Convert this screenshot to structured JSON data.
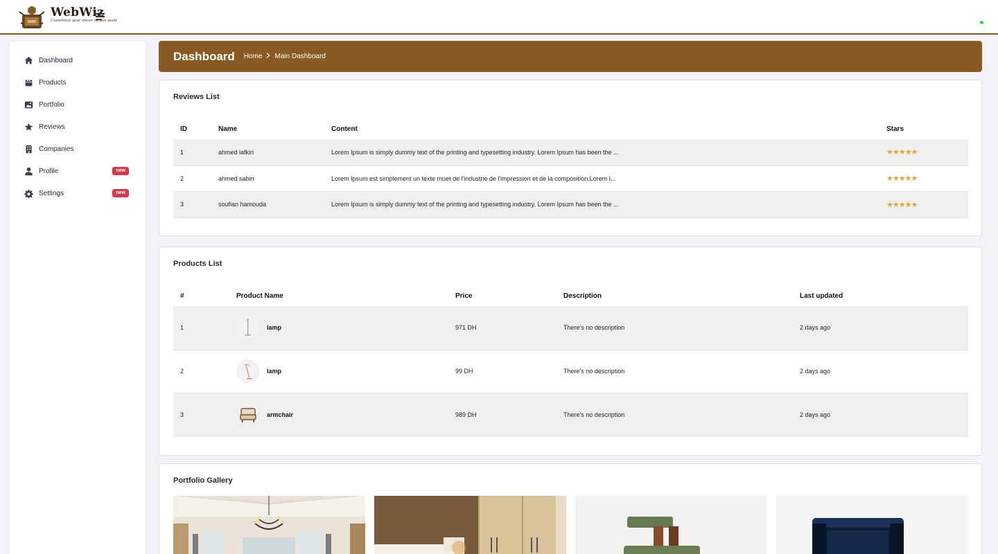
{
  "app": {
    "brand_name": "WebWiz",
    "brand_tagline": "Customize your décor as you want"
  },
  "sidebar": {
    "items": [
      {
        "label": "Dashboard",
        "icon": "home-icon"
      },
      {
        "label": "Products",
        "icon": "box-icon"
      },
      {
        "label": "Portfolio",
        "icon": "image-icon"
      },
      {
        "label": "Reviews",
        "icon": "star-icon"
      },
      {
        "label": "Companies",
        "icon": "building-icon"
      },
      {
        "label": "Profile",
        "icon": "user-icon",
        "badge": "new"
      },
      {
        "label": "Settings",
        "icon": "gear-icon",
        "badge": "new"
      }
    ]
  },
  "header": {
    "title": "Dashboard",
    "breadcrumb": [
      "Home",
      "Main Dashboard"
    ]
  },
  "reviews": {
    "title": "Reviews List",
    "columns": [
      "ID",
      "Name",
      "Content",
      "Stars"
    ],
    "rows": [
      {
        "id": "1",
        "name": "ahmed lafkiri",
        "content": "Lorem Ipsum is simply dummy text of the printing and typesetting industry. Lorem Ipsum has been the ...",
        "stars": "★★★★★",
        "rating": 5
      },
      {
        "id": "2",
        "name": "ahmed sabiri",
        "content": "Lorem Ipsum est simplement un texte muet de l'industrie de l'impression et de la composition.Lorem I...",
        "stars": "★★★★★",
        "rating": 5
      },
      {
        "id": "3",
        "name": "soufian hamouda",
        "content": "Lorem Ipsum is simply dummy text of the printing and typesetting industry. Lorem Ipsum has been the ...",
        "stars": "★★★★★",
        "rating": 5
      }
    ]
  },
  "products": {
    "title": "Products List",
    "columns": [
      "#",
      "Product Name",
      "Price",
      "Description",
      "Last updated"
    ],
    "rows": [
      {
        "num": "1",
        "name": "lamp",
        "price": "971 DH",
        "description": "There's no description",
        "updated": "2 days ago"
      },
      {
        "num": "2",
        "name": "lamp",
        "price": "99 DH",
        "description": "There's no description",
        "updated": "2 days ago"
      },
      {
        "num": "3",
        "name": "armchair",
        "price": "989 DH",
        "description": "There's no description",
        "updated": "2 days ago"
      }
    ]
  },
  "portfolio": {
    "title": "Portfolio Gallery"
  },
  "colors": {
    "brand": "#8a5a23",
    "badge": "#dc3545",
    "star": "#e0a52a",
    "online": "#3ad23a"
  }
}
